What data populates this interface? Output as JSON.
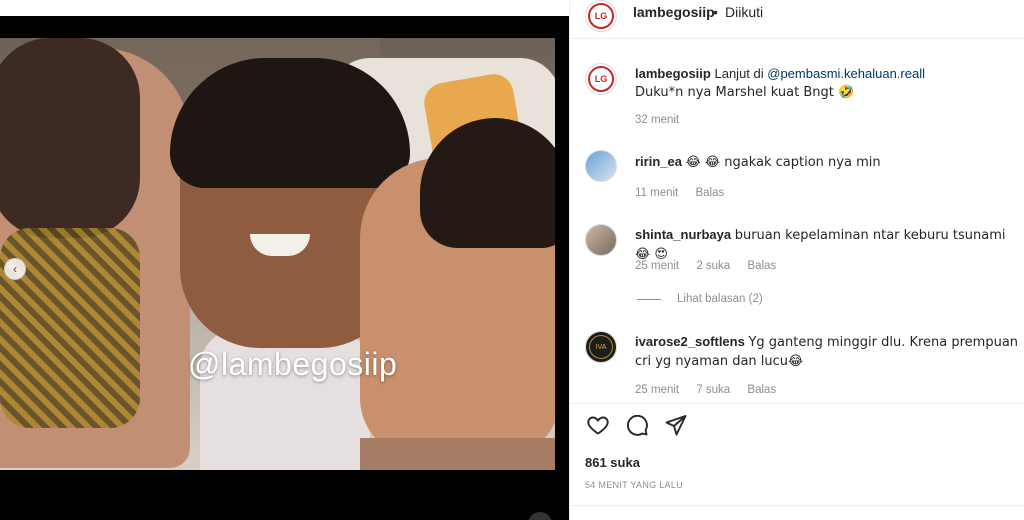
{
  "header": {
    "username": "lambegosiip",
    "separator": "•",
    "follow_status": "Diikuti"
  },
  "media": {
    "watermark": "@lambegosiip"
  },
  "caption": {
    "username": "lambegosiip",
    "text_before_link": "Lanjut di ",
    "link": "@pembasmi.kehaluan.reall",
    "line2": "Duku*n nya Marshel kuat Bngt 🤣",
    "time": "32 menit"
  },
  "comments": [
    {
      "username": "ririn_ea",
      "text": "😂 😂  ngakak caption nya min",
      "time": "11 menit",
      "likes": "",
      "reply": "Balas"
    },
    {
      "username": "shinta_nurbaya",
      "text": "buruan kepelaminan ntar keburu tsunami😂 😍",
      "time": "25 menit",
      "likes": "2 suka",
      "reply": "Balas",
      "view_replies": "Lihat balasan (2)"
    },
    {
      "username": "ivarose2_softlens",
      "text": "Yg ganteng minggir dlu. Krena prempuan cri yg nyaman dan lucu😂",
      "time": "25 menit",
      "likes": "7 suka",
      "reply": "Balas"
    }
  ],
  "actions": {
    "like_icon": "heart-icon",
    "comment_icon": "comment-icon",
    "share_icon": "send-icon"
  },
  "likes_count": "861 suka",
  "posted_ago": "54 MENIT YANG LALU"
}
